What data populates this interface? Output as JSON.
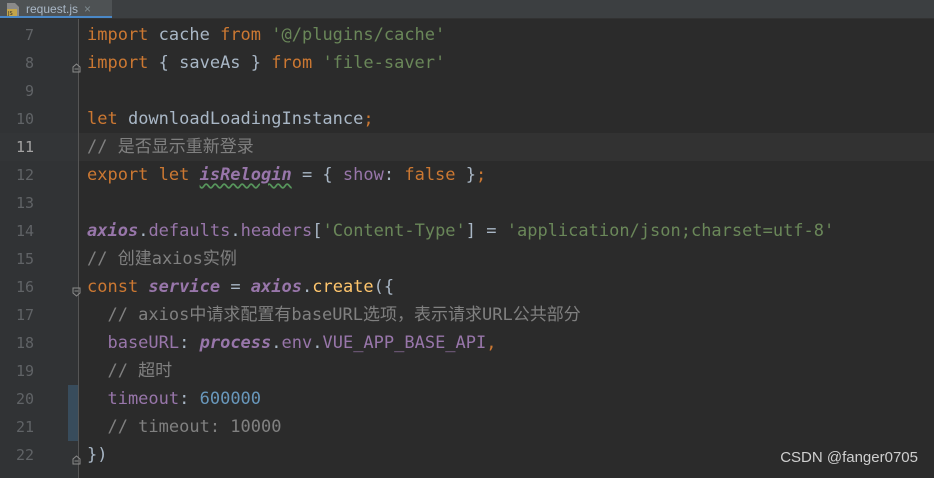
{
  "tab": {
    "filename": "request.js",
    "close": "×",
    "icon": "js-file-icon"
  },
  "lines": [
    {
      "num": "7",
      "parts": [
        [
          "kw",
          "import "
        ],
        [
          "",
          "cache "
        ],
        [
          "kw",
          "from "
        ],
        [
          "str",
          "'@/plugins/cache'"
        ]
      ]
    },
    {
      "num": "8",
      "parts": [
        [
          "kw",
          "import "
        ],
        [
          "",
          "{ saveAs } "
        ],
        [
          "kw",
          "from "
        ],
        [
          "str",
          "'file-saver'"
        ]
      ]
    },
    {
      "num": "9",
      "parts": []
    },
    {
      "num": "10",
      "parts": [
        [
          "kw",
          "let "
        ],
        [
          "",
          "downloadLoadingInstance"
        ],
        [
          "kw",
          ";"
        ]
      ]
    },
    {
      "num": "11",
      "parts": [
        [
          "cmt",
          "// 是否显示重新登录"
        ]
      ]
    },
    {
      "num": "12",
      "parts": [
        [
          "kw",
          "export let "
        ],
        [
          "var-it wavy",
          "isRelogin"
        ],
        [
          "",
          " = { "
        ],
        [
          "prop",
          "show"
        ],
        [
          "",
          ": "
        ],
        [
          "kw",
          "false"
        ],
        [
          "",
          " }"
        ],
        [
          "kw",
          ";"
        ]
      ]
    },
    {
      "num": "13",
      "parts": []
    },
    {
      "num": "14",
      "parts": [
        [
          "glob",
          "axios"
        ],
        [
          "",
          "."
        ],
        [
          "prop",
          "defaults"
        ],
        [
          "",
          "."
        ],
        [
          "prop",
          "headers"
        ],
        [
          "",
          "["
        ],
        [
          "str",
          "'Content-Type'"
        ],
        [
          "",
          "] = "
        ],
        [
          "str",
          "'application/json;charset=utf-8'"
        ]
      ]
    },
    {
      "num": "15",
      "parts": [
        [
          "cmt",
          "// 创建axios实例"
        ]
      ]
    },
    {
      "num": "16",
      "parts": [
        [
          "kw",
          "const "
        ],
        [
          "var-it",
          "service"
        ],
        [
          "",
          " = "
        ],
        [
          "glob",
          "axios"
        ],
        [
          "",
          "."
        ],
        [
          "func",
          "create"
        ],
        [
          "",
          "({"
        ]
      ]
    },
    {
      "num": "17",
      "parts": [
        [
          "cmt",
          "  // axios中请求配置有baseURL选项，表示请求URL公共部分"
        ]
      ]
    },
    {
      "num": "18",
      "parts": [
        [
          "prop",
          "  baseURL"
        ],
        [
          "",
          ": "
        ],
        [
          "glob",
          "process"
        ],
        [
          "",
          "."
        ],
        [
          "prop",
          "env"
        ],
        [
          "",
          "."
        ],
        [
          "prop",
          "VUE_APP_BASE_API"
        ],
        [
          "kw",
          ","
        ]
      ]
    },
    {
      "num": "19",
      "parts": [
        [
          "cmt",
          "  // 超时"
        ]
      ]
    },
    {
      "num": "20",
      "parts": [
        [
          "prop",
          "  timeout"
        ],
        [
          "",
          ": "
        ],
        [
          "num",
          "600000"
        ]
      ]
    },
    {
      "num": "21",
      "parts": [
        [
          "cmt",
          "  // timeout: 10000"
        ]
      ]
    },
    {
      "num": "22",
      "parts": [
        [
          "",
          "})"
        ]
      ]
    }
  ],
  "current_line": "11",
  "watermark": "CSDN @fanger0705"
}
